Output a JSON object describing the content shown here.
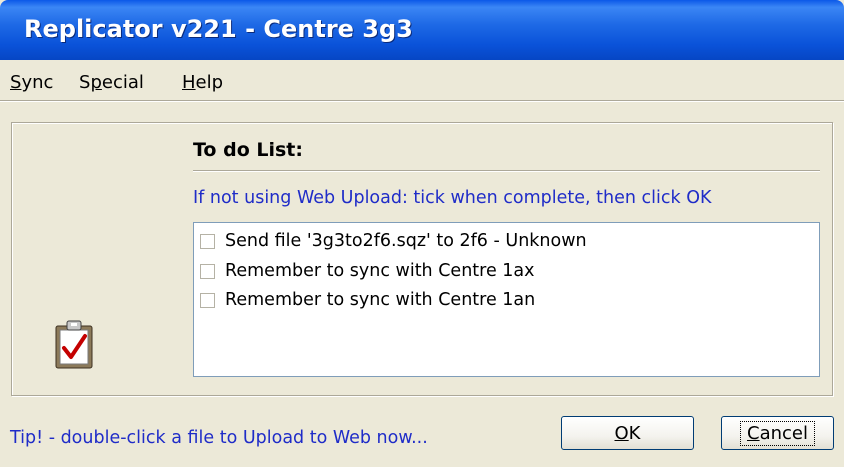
{
  "window": {
    "title": "Replicator v221 - Centre 3g3"
  },
  "menu": {
    "items": [
      {
        "label": "Sync",
        "mnemonic": "S"
      },
      {
        "label": "Special",
        "mnemonic": "p"
      },
      {
        "label": "Help",
        "mnemonic": "H"
      }
    ]
  },
  "todo": {
    "title": "To do List:",
    "instruction": "If not using Web Upload: tick when complete, then click OK",
    "items": [
      {
        "label": "Send file '3g3to2f6.sqz' to 2f6 - Unknown",
        "checked": false
      },
      {
        "label": "Remember to sync with Centre 1ax",
        "checked": false
      },
      {
        "label": "Remember to sync with Centre 1an",
        "checked": false
      }
    ]
  },
  "footer": {
    "tip": "Tip! - double-click a file to Upload to Web now...",
    "ok_label": "OK",
    "cancel_label": "Cancel"
  },
  "icons": {
    "todo": "clipboard-check-icon"
  },
  "colors": {
    "titlebar": "#0a52d9",
    "instruction_text": "#1f2cc8",
    "dialog_bg": "#ece9d8"
  }
}
